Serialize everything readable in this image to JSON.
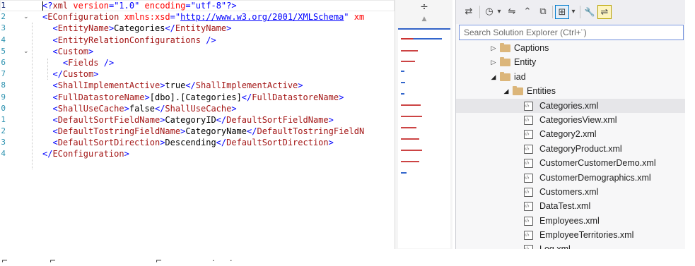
{
  "editor": {
    "line_numbers": [
      "1",
      "2",
      "3",
      "4",
      "5",
      "6",
      "7",
      "8",
      "9",
      "0",
      "1",
      "2",
      "3",
      "4"
    ],
    "code": {
      "prolog_open": "<?",
      "prolog_name": "xml",
      "version_attr": "version",
      "version_val": "\"1.0\"",
      "encoding_attr": "encoding",
      "encoding_val": "\"utf-8\"",
      "prolog_close": "?>",
      "root_tag": "EConfiguration",
      "xmlns_attr": "xmlns:xsd",
      "xmlns_url": "http://www.w3.org/2001/XMLSchema",
      "xmlns_tail": " xm",
      "entity_name_tag": "EntityName",
      "entity_name_val": "Categories",
      "relations_tag": "EntityRelationConfigurations",
      "custom_tag": "Custom",
      "fields_tag": "Fields",
      "shall_active_tag": "ShallImplementActive",
      "shall_active_val": "true",
      "datastore_tag": "FullDatastoreName",
      "datastore_val": "[dbo].[Categories]",
      "cache_tag": "ShallUseCache",
      "cache_val": "false",
      "sort_field_tag": "DefaultSortFieldName",
      "sort_field_val": "CategoryID",
      "tostring_tag": "DefaultTostringFieldName",
      "tostring_val": "CategoryName",
      "tostring_close_cut": "DefaultTostringFieldN",
      "sort_dir_tag": "DefaultSortDirection",
      "sort_dir_val": "Descending"
    }
  },
  "overview": {
    "split_glyph": "÷",
    "scroll_up_glyph": "▲"
  },
  "solution_explorer": {
    "search_placeholder": "Search Solution Explorer (Ctrl+¨)",
    "toolbar": {
      "sync_icon": "⇄",
      "history_icon": "◷",
      "dropdown_icon": "▾",
      "refresh_icon": "⇋",
      "collapse_icon": "⌃",
      "copy_icon": "⧉",
      "pin_icon": "⊞",
      "settings_icon": "🔧",
      "preview_icon": "⇌"
    },
    "tree": [
      {
        "label": "Captions",
        "kind": "folder",
        "expander": "▷",
        "level": 1
      },
      {
        "label": "Entity",
        "kind": "folder",
        "expander": "▷",
        "level": 1
      },
      {
        "label": "iad",
        "kind": "folder",
        "expander": "◢",
        "level": 1
      },
      {
        "label": "Entities",
        "kind": "folder",
        "expander": "◢",
        "level": 2
      },
      {
        "label": "Categories.xml",
        "kind": "xml",
        "expander": "",
        "level": 3,
        "selected": true
      },
      {
        "label": "CategoriesView.xml",
        "kind": "xml",
        "expander": "",
        "level": 3
      },
      {
        "label": "Category2.xml",
        "kind": "xml",
        "expander": "",
        "level": 3
      },
      {
        "label": "CategoryProduct.xml",
        "kind": "xml",
        "expander": "",
        "level": 3
      },
      {
        "label": "CustomerCustomerDemo.xml",
        "kind": "xml",
        "expander": "",
        "level": 3
      },
      {
        "label": "CustomerDemographics.xml",
        "kind": "xml",
        "expander": "",
        "level": 3
      },
      {
        "label": "Customers.xml",
        "kind": "xml",
        "expander": "",
        "level": 3
      },
      {
        "label": "DataTest.xml",
        "kind": "xml",
        "expander": "",
        "level": 3
      },
      {
        "label": "Employees.xml",
        "kind": "xml",
        "expander": "",
        "level": 3
      },
      {
        "label": "EmployeeTerritories.xml",
        "kind": "xml",
        "expander": "",
        "level": 3
      },
      {
        "label": "Log.xml",
        "kind": "xml",
        "expander": "",
        "level": 3
      }
    ]
  },
  "colors": {
    "tag": "#a31515",
    "punctuation": "#0000ff",
    "attribute": "#ff0000",
    "line_number": "#2b91af",
    "selection": "#e6e6e9",
    "search_border": "#6e8ddb"
  }
}
